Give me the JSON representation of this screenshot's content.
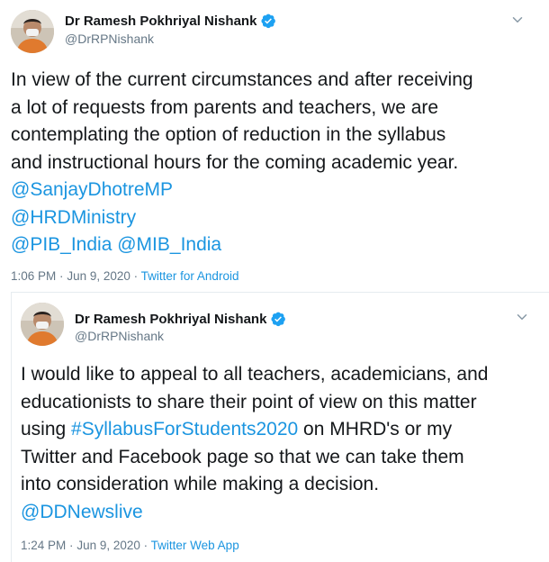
{
  "tweets": [
    {
      "author": {
        "display_name": "Dr Ramesh Pokhriyal Nishank",
        "handle": "@DrRPNishank",
        "verified": true
      },
      "avatar_icon": "person-avatar",
      "menu_icon": "chevron-down-icon",
      "text_lines": [
        "In view of the current circumstances and after receiving",
        "a lot of requests from parents and teachers, we are",
        "contemplating the option of reduction in the syllabus",
        "and instructional hours for the coming academic year."
      ],
      "mentions": {
        "line1": "@SanjayDhotreMP",
        "line2": "@HRDMinistry",
        "line3a": "@PIB_India",
        "line3b": "@MIB_India"
      },
      "time": "1:06 PM",
      "date": "Jun 9, 2020",
      "separator": "·",
      "source": "Twitter for Android"
    },
    {
      "author": {
        "display_name": "Dr Ramesh Pokhriyal Nishank",
        "handle": "@DrRPNishank",
        "verified": true
      },
      "avatar_icon": "person-avatar",
      "menu_icon": "chevron-down-icon",
      "text": {
        "line1": "I would like to appeal to all teachers, academicians, and",
        "line2": "educationists to share their point of view on this matter",
        "line3_pre": "using ",
        "hashtag": "#SyllabusForStudents2020",
        "line3_post": " on MHRD's or my",
        "line4": "Twitter and Facebook page so that we can take them",
        "line5": "into consideration while making a decision."
      },
      "mention": "@DDNewslive",
      "time": "1:24 PM",
      "date": "Jun 9, 2020",
      "separator": "·",
      "source": "Twitter Web App"
    }
  ],
  "colors": {
    "link": "#1b95e0",
    "text": "#14171a",
    "muted": "#657786",
    "verified": "#1da1f2",
    "border": "#e6ecf0"
  }
}
